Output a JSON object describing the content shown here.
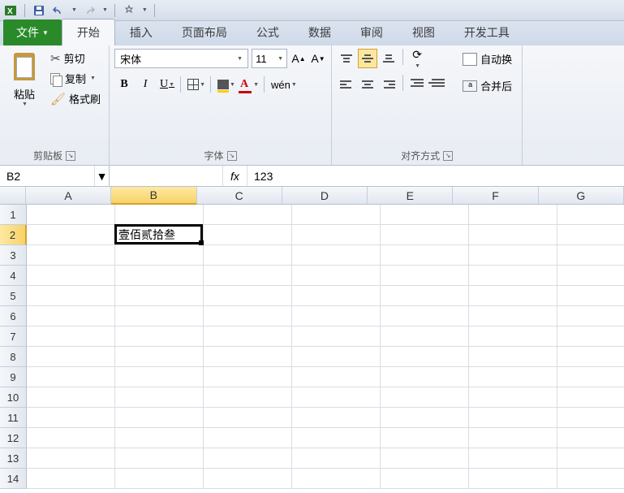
{
  "qat": {
    "save_title": "保存",
    "undo_title": "撤销",
    "redo_title": "重做"
  },
  "tabs": {
    "file": "文件",
    "home": "开始",
    "insert": "插入",
    "page_layout": "页面布局",
    "formulas": "公式",
    "data": "数据",
    "review": "审阅",
    "view": "视图",
    "developer": "开发工具"
  },
  "ribbon": {
    "clipboard": {
      "label": "剪贴板",
      "paste": "粘贴",
      "cut": "剪切",
      "copy": "复制",
      "format_painter": "格式刷"
    },
    "font": {
      "label": "字体",
      "name": "宋体",
      "size": "11"
    },
    "alignment": {
      "label": "对齐方式"
    },
    "wrap": "自动换",
    "merge": "合并后"
  },
  "formula_bar": {
    "name_box": "B2",
    "fx": "fx",
    "value": "123"
  },
  "grid": {
    "columns": [
      "A",
      "B",
      "C",
      "D",
      "E",
      "F",
      "G"
    ],
    "rows": [
      "1",
      "2",
      "3",
      "4",
      "5",
      "6",
      "7",
      "8",
      "9",
      "10",
      "11",
      "12",
      "13",
      "14"
    ],
    "active_col": "B",
    "active_row": "2",
    "cells": {
      "B2": "壹佰贰拾叁"
    }
  }
}
